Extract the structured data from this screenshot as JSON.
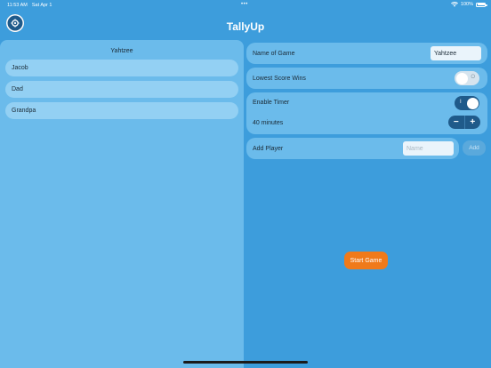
{
  "status_bar": {
    "time": "11:53 AM",
    "date": "Sat Apr 1",
    "battery": "100%"
  },
  "app": {
    "title": "TallyUp"
  },
  "game_list": {
    "title": "Yahtzee",
    "players": [
      "Jacob",
      "Dad",
      "Grandpa"
    ]
  },
  "settings": {
    "name_of_game_label": "Name of Game",
    "name_of_game_value": "Yahtzee",
    "lowest_score_label": "Lowest Score Wins",
    "lowest_score_on": false,
    "toggle_off_mark": "O",
    "toggle_on_mark": "I",
    "enable_timer_label": "Enable Timer",
    "enable_timer_on": true,
    "timer_value": "40 minutes",
    "stepper_minus": "−",
    "stepper_plus": "+",
    "add_player_label": "Add Player",
    "add_player_placeholder": "Name",
    "add_button": "Add"
  },
  "actions": {
    "start_game": "Start Game"
  },
  "colors": {
    "background": "#3d9ddc",
    "panel": "#6bbbeb",
    "row": "#93d0f3",
    "accent_dark": "#1f5a8a",
    "start_button": "#f07a1a"
  }
}
